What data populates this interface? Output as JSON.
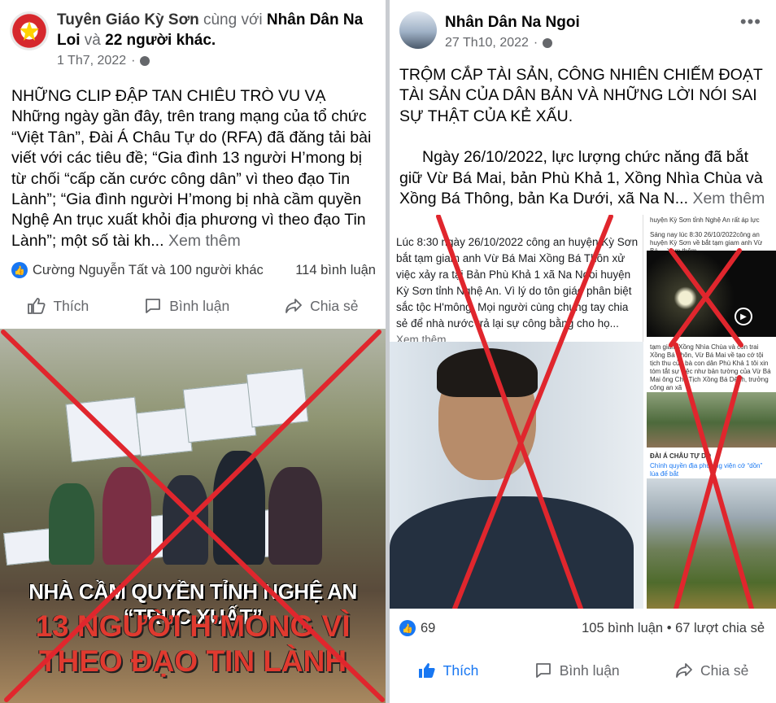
{
  "left_post": {
    "author_prefix": "Tuyên Giáo Kỳ Sơn",
    "with_text": "cùng với",
    "with_name": "Nhân Dân Na Loi",
    "and_text": "và",
    "others": "22 người khác.",
    "date": "1 Th7, 2022",
    "body": {
      "headline": "NHỮNG CLIP ĐẬP TAN CHIÊU TRÒ VU VẠ",
      "text": "Những ngày gần đây, trên trang mạng của tổ chức “Việt Tân”, Đài Á Châu Tự do (RFA) đã đăng tải bài viết với các tiêu đề; “Gia đình 13 người H’mong bị từ chối “cấp căn cước công dân” vì theo đạo Tin Lành”; “Gia đình người H’mong bị nhà cầm quyền Nghệ An trục xuất khỏi địa phương vì theo đạo Tin Lành”; một số tài kh...",
      "see_more": "Xem thêm"
    },
    "reactions": {
      "names": "Cường Nguyễn Tất và 100 người khác",
      "comments": "114 bình luận"
    },
    "actions": {
      "like": "Thích",
      "comment": "Bình luận",
      "share": "Chia sẻ"
    },
    "image": {
      "line1": "NHÀ CẦM QUYỀN TỈNH NGHỆ AN “TRỤC XUẤT”",
      "line2": "13 NGƯỜI H’MONG VÌ",
      "line3": "THEO ĐẠO TIN LÀNH"
    }
  },
  "right_post": {
    "author": "Nhân Dân Na Ngoi",
    "date": "27 Th10, 2022",
    "more": "•••",
    "body": {
      "headline": "TRỘM CẮP TÀI SẢN, CÔNG NHIÊN CHIẾM ĐOẠT TÀI SẢN CỦA DÂN BẢN VÀ NHỮNG LỜI NÓI SAI SỰ THẬT CỦA KẺ XẤU.",
      "text": "Ngày 26/10/2022, lực lượng chức năng đã bắt giữ Vừ Bá Mai, bản Phù Khả 1, Xồng Nhìa Chùa và Xồng Bá Thông, bản Ka Dưới, xã Na N...",
      "see_more": "Xem thêm"
    },
    "collage": {
      "caption": "Lúc 8:30 ngày 26/10/2022 công an huyện Kỳ Sơn bắt tạm giam anh Vừ Bá Mai Xồng Bá Thôn xử việc xảy ra tại Bản Phù Khả 1 xã Na Ngoi huyện Kỳ Sơn tỉnh Nghệ An. Vì lý do tôn giáo phân biệt sắc tộc H'mông. Mọi người cùng chung tay chia sẻ để nhà nước trả lại sự công bằng cho họ...",
      "caption_more": "Xem thêm",
      "side1": "huyện Kỳ Sơn tỉnh Nghệ An rất áp lực",
      "side2": "Sáng nay lúc 8:30 26/10/2022công an huyện Kỳ Sơn về bắt tạm giam anh Vừ Bá ... Xem thêm",
      "side3": "tạm giam Xồng Nhìa Chùa và con trai Xồng Bá Thôn, Vừ Bá Mai về tạo cớ tội tịch thu của bà con dân Phù Khả 1 tôi xin tóm tắt sự việc như bản tường của Vừ Bá Mai ông Chủ Tịch Xồng Bá Dênh, trưởng công an xã",
      "side4_tag": "ĐÀI Á CHÂU TỰ DO",
      "side4": "Chính quyền địa phương viện cớ “dồn” lúa để bắt"
    },
    "reactions": {
      "count": "69",
      "comments": "105 bình luận",
      "shares": "67 lượt chia sẻ",
      "sep": "•"
    },
    "actions": {
      "like": "Thích",
      "comment": "Bình luận",
      "share": "Chia sẻ"
    }
  },
  "colors": {
    "facebook_blue": "#1877f2",
    "cross_red": "#e0262d",
    "meta_gray": "#65676b"
  }
}
